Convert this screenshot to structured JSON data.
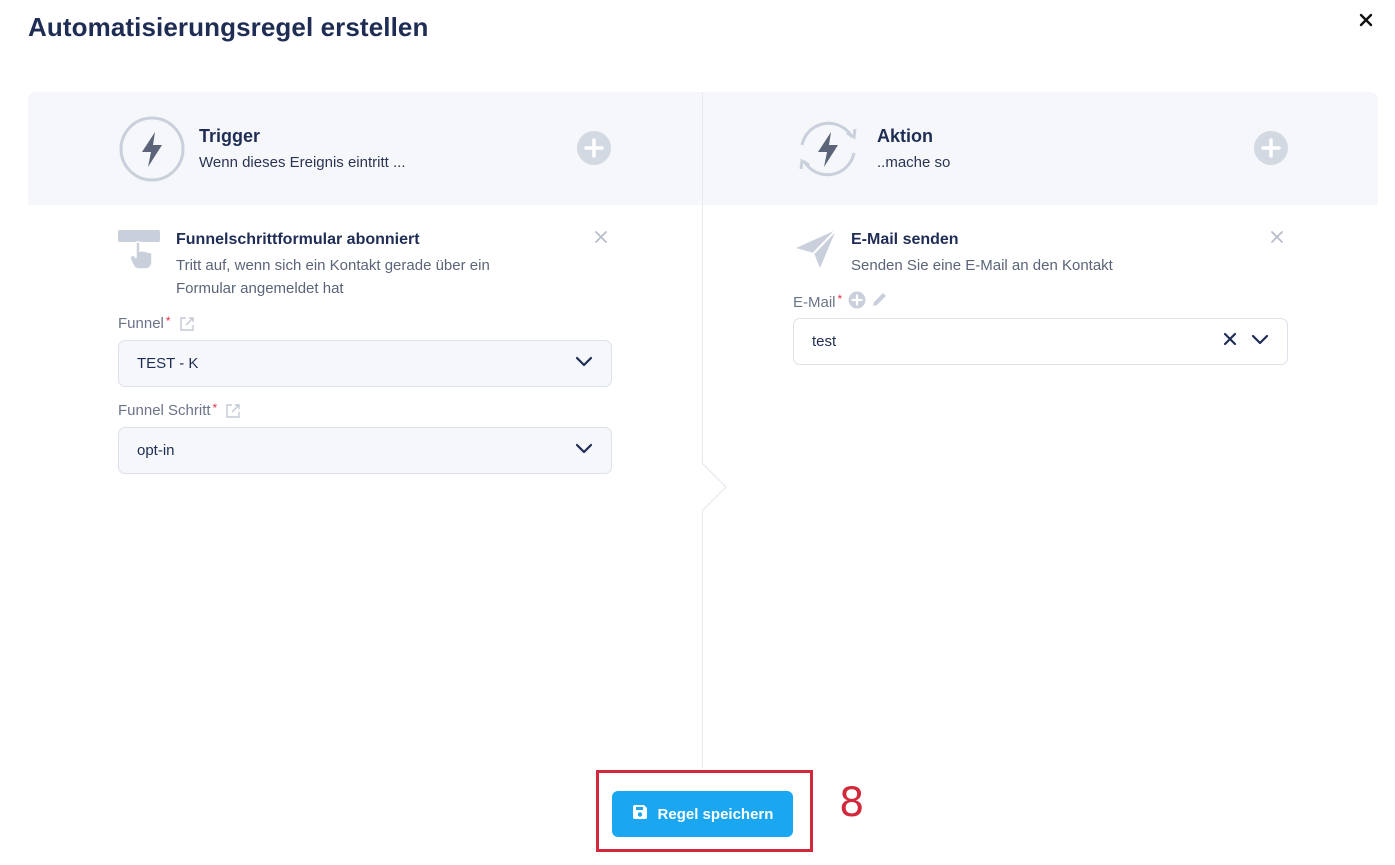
{
  "modal": {
    "title": "Automatisierungsregel erstellen",
    "close_icon": "close-icon"
  },
  "trigger_panel": {
    "title": "Trigger",
    "subtitle": "Wenn dieses Ereignis eintritt ...",
    "icon": "lightning-circle-icon",
    "add_icon": "plus-circle-icon",
    "item": {
      "title": "Funnelschrittformular abonniert",
      "description_line1": "Tritt auf, wenn sich ein Kontakt gerade über ein",
      "description_line2": "Formular angemeldet hat",
      "icon": "form-touch-icon"
    },
    "fields": [
      {
        "label": "Funnel",
        "required_mark": "*",
        "value": "TEST - K"
      },
      {
        "label": "Funnel Schritt",
        "required_mark": "*",
        "value": "opt-in"
      }
    ]
  },
  "action_panel": {
    "title": "Aktion",
    "subtitle": "..mache so",
    "icon": "lightning-sync-icon",
    "add_icon": "plus-circle-icon",
    "item": {
      "title": "E-Mail senden",
      "description": "Senden Sie eine E-Mail an den Kontakt",
      "icon": "paper-plane-icon"
    },
    "email_field": {
      "label": "E-Mail",
      "required_mark": "*",
      "value": "test"
    }
  },
  "footer": {
    "save_label": "Regel speichern",
    "save_icon": "floppy-disk-icon"
  },
  "annotation": {
    "number": "8"
  },
  "colors": {
    "primary": "#1aa6f0",
    "title": "#1f2d55",
    "panel_bg": "#f5f7fa",
    "annotation_red": "#d1293b",
    "required": "#e0304a"
  }
}
